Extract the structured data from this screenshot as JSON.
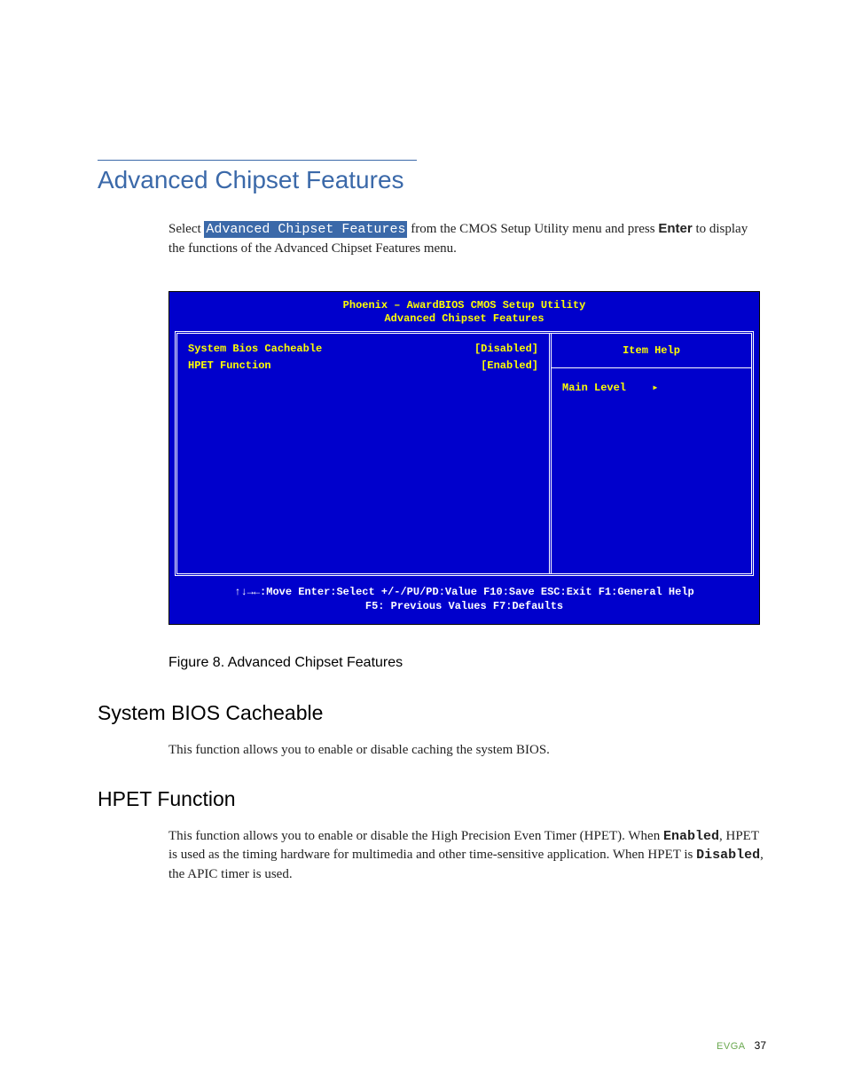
{
  "title": "Advanced Chipset Features",
  "intro_pre": "Select ",
  "intro_menu": "Advanced Chipset Features",
  "intro_mid": " from the CMOS Setup Utility menu and press ",
  "intro_enter": "Enter",
  "intro_post": " to display the functions of the Advanced Chipset Features menu.",
  "bios": {
    "header_line1": "Phoenix – AwardBIOS CMOS Setup Utility",
    "header_line2": "Advanced Chipset Features",
    "rows": [
      {
        "label": "System Bios Cacheable",
        "value": "[Disabled]"
      },
      {
        "label": "HPET Function",
        "value": "[Enabled]"
      }
    ],
    "item_help": "Item Help",
    "main_level": "Main Level",
    "footer_line1": "↑↓→←:Move  Enter:Select  +/-/PU/PD:Value  F10:Save  ESC:Exit  F1:General Help",
    "footer_line2": "F5: Previous Values          F7:Defaults"
  },
  "figure": "Figure 8.        Advanced Chipset Features",
  "section1": {
    "title": "System BIOS Cacheable",
    "body": "This function allows you to enable or disable caching the system BIOS."
  },
  "section2": {
    "title": "HPET Function",
    "body_pre": "This function allows you to enable or disable the High Precision Even Timer (HPET). When ",
    "body_enabled": "Enabled",
    "body_mid": ", HPET is used as the timing hardware for multimedia and other time-sensitive application. When HPET is ",
    "body_disabled": "Disabled",
    "body_post": ", the APIC timer is used."
  },
  "footer_brand": "EVGA",
  "footer_page": "37"
}
